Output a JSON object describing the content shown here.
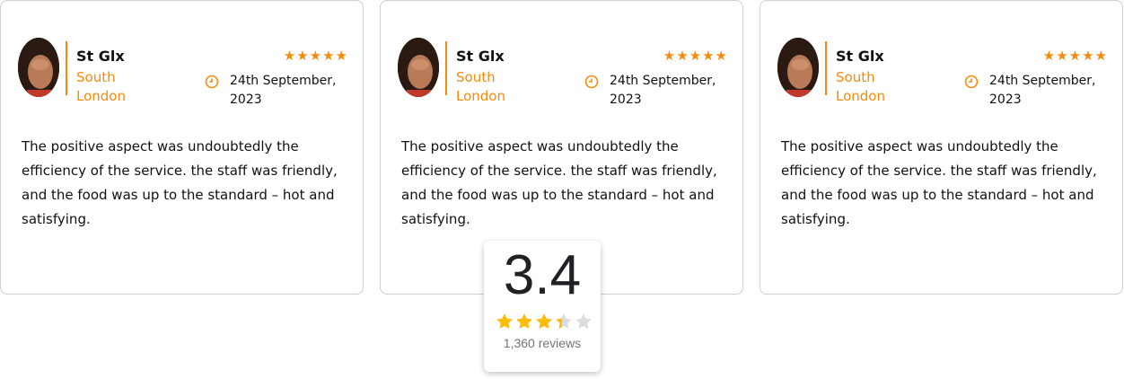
{
  "colors": {
    "accent": "#f28c0f",
    "google_star": "#fbbc04",
    "star_empty": "#dadce0"
  },
  "reviews": [
    {
      "name": "St Glx",
      "location": "South London",
      "stars": "★★★★★",
      "date": "24th September, 2023",
      "text": "The positive aspect was undoubtedly the efficiency of the service. the staff was friendly, and the food was up to the standard – hot and satisfying."
    },
    {
      "name": "St Glx",
      "location": "South London",
      "stars": "★★★★★",
      "date": "24th September, 2023",
      "text": "The positive aspect was undoubtedly the efficiency of the service. the staff was friendly, and the food was up to the standard – hot and satisfying."
    },
    {
      "name": "St Glx",
      "location": "South London",
      "stars": "★★★★★",
      "date": "24th September, 2023",
      "text": "The positive aspect was undoubtedly the efficiency of the service. the staff was friendly, and the food was up to the standard – hot and satisfying."
    }
  ],
  "rating": {
    "score": "3.4",
    "stars_value": 3.4,
    "stars_max": 5,
    "count": "1,360 reviews"
  }
}
